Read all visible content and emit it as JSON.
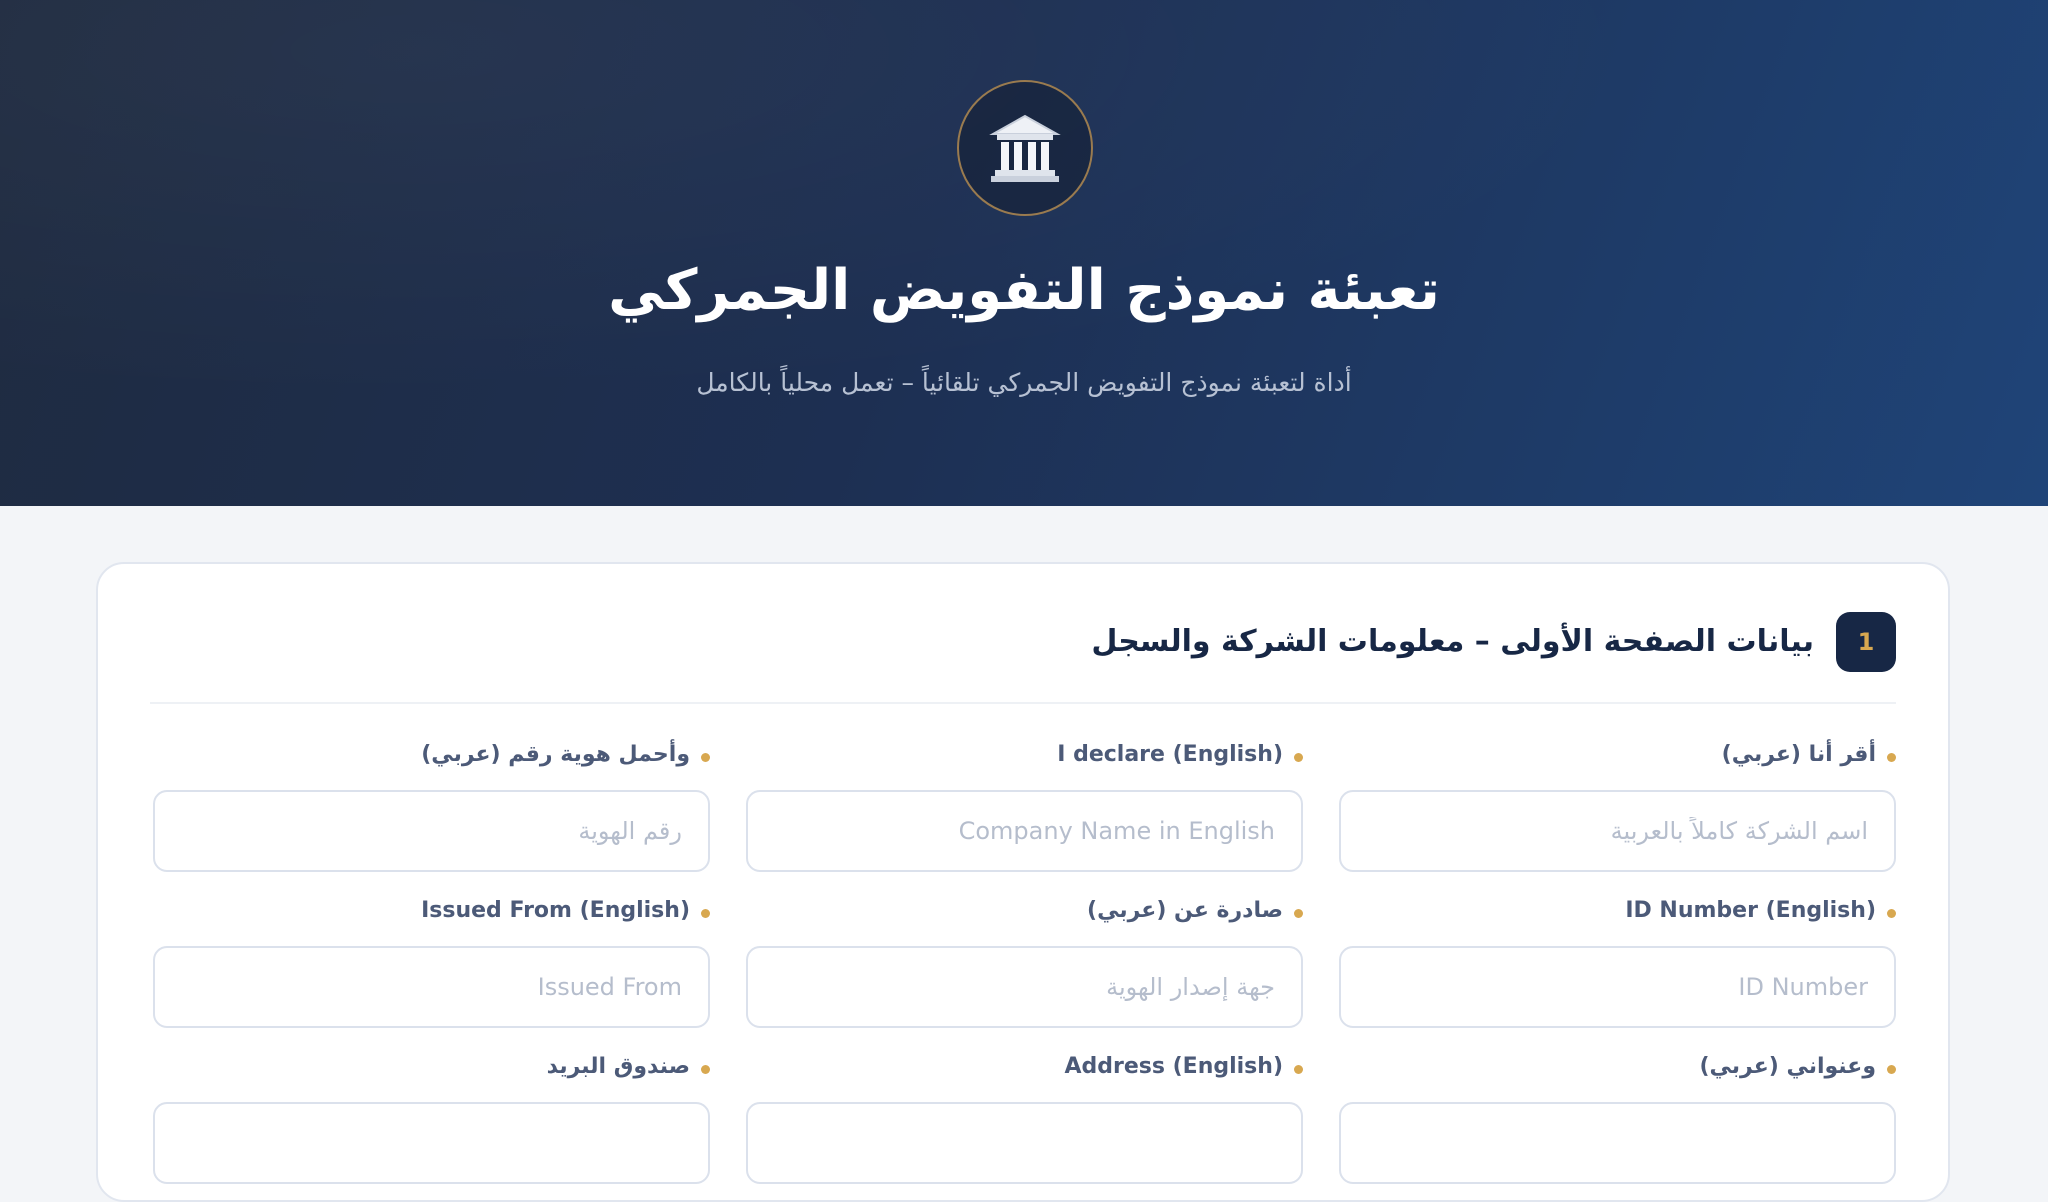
{
  "header": {
    "emblem_icon": "government-building-icon",
    "title": "تعبئة نموذج التفويض الجمركي",
    "subtitle": "أداة لتعبئة نموذج التفويض الجمركي تلقائياً – تعمل محلياً بالكامل"
  },
  "section": {
    "step_number": "1",
    "title": "بيانات الصفحة الأولى – معلومات الشركة والسجل"
  },
  "fields": [
    {
      "label": "أقر أنا (عربي)",
      "placeholder": "اسم الشركة كاملاً بالعربية",
      "value": ""
    },
    {
      "label": "I declare (English)",
      "placeholder": "Company Name in English",
      "value": ""
    },
    {
      "label": "وأحمل هوية رقم (عربي)",
      "placeholder": "رقم الهوية",
      "value": ""
    },
    {
      "label": "ID Number (English)",
      "placeholder": "ID Number",
      "value": ""
    },
    {
      "label": "صادرة عن (عربي)",
      "placeholder": "جهة إصدار الهوية",
      "value": ""
    },
    {
      "label": "Issued From (English)",
      "placeholder": "Issued From",
      "value": ""
    },
    {
      "label": "وعنواني (عربي)",
      "placeholder": "",
      "value": ""
    },
    {
      "label": "Address (English)",
      "placeholder": "",
      "value": ""
    },
    {
      "label": "صندوق البريد",
      "placeholder": "",
      "value": ""
    }
  ],
  "colors": {
    "header_dark": "#1f2b40",
    "header_blue": "#1f4478",
    "accent_gold": "#d8a850",
    "badge_bg": "#172745",
    "page_bg": "#f3f5f8"
  }
}
